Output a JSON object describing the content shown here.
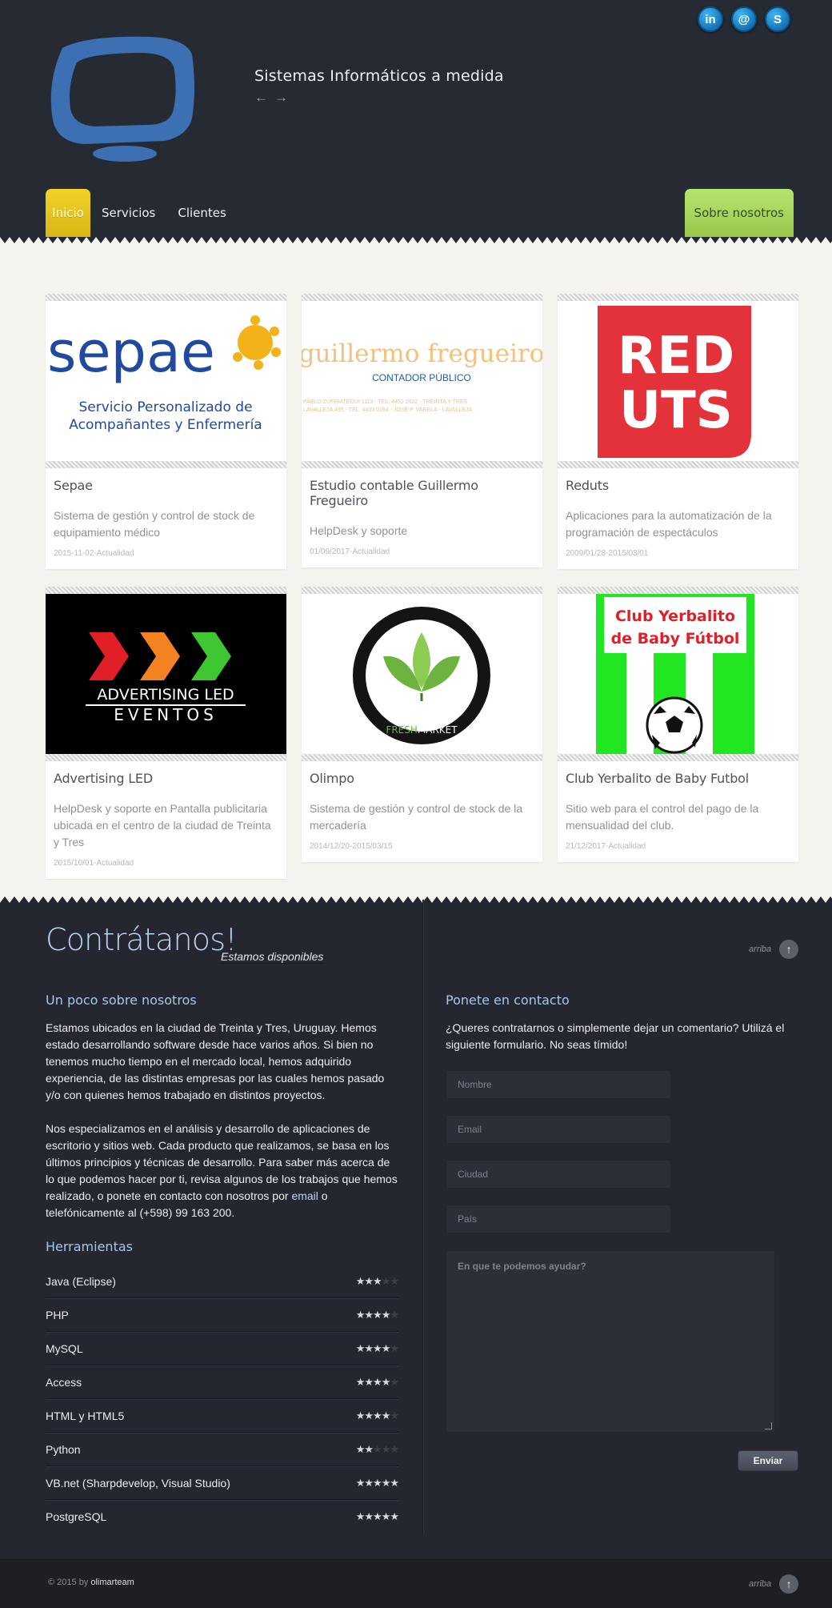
{
  "header": {
    "tagline": "Sistemas Informáticos a medida",
    "arrow_prev": "←",
    "arrow_next": "→",
    "social": [
      {
        "icon": "linkedin-icon",
        "label": "in"
      },
      {
        "icon": "at-icon",
        "label": "@"
      },
      {
        "icon": "skype-icon",
        "label": "S"
      }
    ],
    "logo_icon": "monitor-icon",
    "colors": {
      "brand_blue": "#3d70b2",
      "nav_active": "#f2d326",
      "nav_about": "#b7e371"
    }
  },
  "nav": {
    "items": [
      "Inicio",
      "Servicios",
      "Clientes"
    ],
    "about": "Sobre nosotros"
  },
  "portfolio": [
    {
      "title": "Sepae",
      "desc": "Sistema de gestión y control de stock de equipamiento médico",
      "date": "2015-11-02-Actualidad",
      "logo": {
        "word": "sepae",
        "line1": "Servicio Personalizado de",
        "line2": "Acompañantes y Enfermería"
      }
    },
    {
      "title": "Estudio contable Guillermo Fregueiro",
      "desc": "HelpDesk y soporte",
      "date": "01/09/2017-Actualidad",
      "logo": {
        "word": "guillermo fregueiro",
        "line1": "CONTADOR PÚBLICO",
        "line2": "PABLO ZUFRIATEGUI 1113 - TEL. 4452 2622 - TREINTA Y TRES",
        "line3": "LAVALLEJA 495 - TEL. 4433 0164 - JOSÉ P. VARELA - LAVALLEJA"
      }
    },
    {
      "title": "Reduts",
      "desc": "Aplicaciones para la automatización de la programación de espectáculos",
      "date": "2009/01/28-2015/03/01",
      "logo": {
        "line1": "RED",
        "line2": "UTS"
      }
    },
    {
      "title": "Advertising LED",
      "desc": "HelpDesk y soporte en Pantalla publicitaria ubicada en el centro de la ciudad de Treinta y Tres",
      "date": "2015/10/01-Actualidad",
      "logo": {
        "line1": "ADVERTISING LED",
        "line2": "EVENTOS"
      }
    },
    {
      "title": "Olimpo",
      "desc": "Sistema de gestión y control de stock de la mercadería",
      "date": "2014/12/20-2015/03/15",
      "logo": {
        "word_a": "FRESH",
        "word_b": "MARKET"
      }
    },
    {
      "title": "Club Yerbalito de Baby Futbol",
      "desc": "Sitio web para el control del pago de la mensualidad del club.",
      "date": "21/12/2017-Actualidad",
      "logo": {
        "line1": "Club Yerbalito",
        "line2": "de Baby Fútbol"
      }
    }
  ],
  "contact_section": {
    "title": "Contrátanos!",
    "subtitle": "Estamos disponibles",
    "up_label": "arriba",
    "up_arrow": "↑",
    "about_title": "Un poco sobre nosotros",
    "about_p1": "Estamos ubicados en la ciudad de Treinta y Tres, Uruguay. Hemos estado desarrollando software desde hace varios años. Si bien no tenemos mucho tiempo en el mercado local, hemos adquirido experiencia, de las distintas empresas por las cuales hemos pasado y/o con quienes hemos trabajado en distintos proyectos.",
    "about_p2_a": "Nos especializamos en el análisis y desarrollo de aplicaciones de escritorio y sitios web. Cada producto que realizamos, se basa en los últimos principios y técnicas de desarrollo. Para saber más acerca de lo que podemos hacer por ti, revisa algunos de los trabajos que hemos realizado, o ponete en contacto con nosotros por ",
    "about_p2_link": "email",
    "about_p2_b": " o telefónicamente al (+598) 99 163 200.",
    "tools_title": "Herramientas",
    "tools": [
      {
        "name": "Java (Eclipse)",
        "rating": 3
      },
      {
        "name": "PHP",
        "rating": 4
      },
      {
        "name": "MySQL",
        "rating": 4
      },
      {
        "name": "Access",
        "rating": 4
      },
      {
        "name": "HTML y HTML5",
        "rating": 4
      },
      {
        "name": "Python",
        "rating": 2
      },
      {
        "name": "VB.net (Sharpdevelop, Visual Studio)",
        "rating": 5
      },
      {
        "name": "PostgreSQL",
        "rating": 5
      }
    ],
    "contact_title": "Ponete en contacto",
    "contact_text": "¿Queres contratarnos o simplemente dejar un comentario? Utilizá el siguiente formulario. No seas tímido!",
    "fields": {
      "name": "Nombre",
      "email": "Email",
      "city": "Ciudad",
      "country": "País",
      "message": "En que te podemos ayudar?"
    },
    "send": "Enviar"
  },
  "footer": {
    "copyright": "© 2015 by ",
    "author": "olimarteam",
    "up_label": "arriba",
    "up_arrow": "↑"
  }
}
